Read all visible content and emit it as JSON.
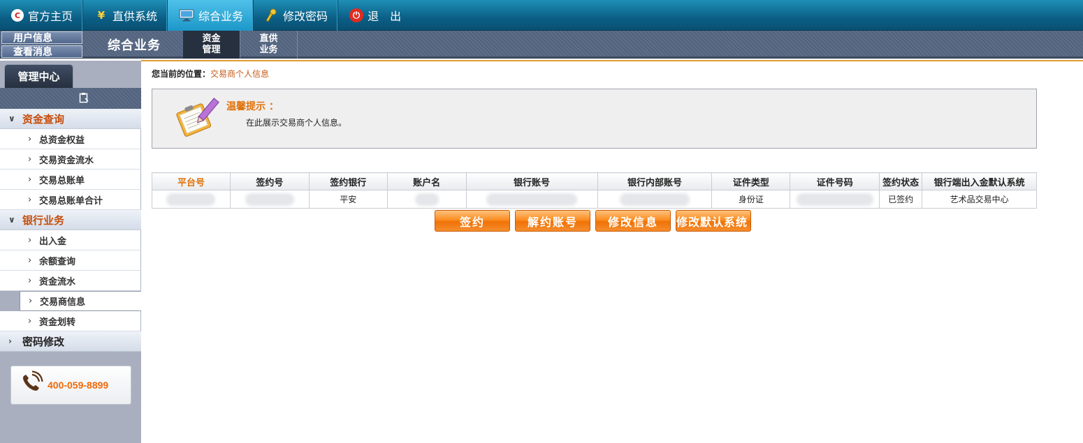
{
  "topnav": {
    "items": [
      {
        "label": "官方主页"
      },
      {
        "label": "直供系统"
      },
      {
        "label": "综合业务"
      },
      {
        "label": "修改密码"
      },
      {
        "label": "退　出"
      }
    ]
  },
  "secbar": {
    "user_info": "用户信息",
    "view_msg": "查看消息",
    "title": "综合业务",
    "tabs": [
      {
        "line1": "资金",
        "line2": "管理"
      },
      {
        "line1": "直供",
        "line2": "业务"
      }
    ]
  },
  "sidebar": {
    "tab": "管理中心",
    "groups": [
      {
        "label": "资金查询",
        "items": [
          "总资金权益",
          "交易资金流水",
          "交易总账单",
          "交易总账单合计"
        ]
      },
      {
        "label": "银行业务",
        "items": [
          "出入金",
          "余额查询",
          "资金流水",
          "交易商信息",
          "资金划转"
        ]
      },
      {
        "label": "密码修改",
        "items": []
      }
    ],
    "phone": "400-059-8899"
  },
  "main": {
    "crumb_label": "您当前的位置：",
    "crumb_current": "交易商个人信息",
    "tip_title": "温馨提示 ：",
    "tip_text": "在此展示交易商个人信息。",
    "table": {
      "headers": [
        "平台号",
        "签约号",
        "签约银行",
        "账户名",
        "银行账号",
        "银行内部账号",
        "证件类型",
        "证件号码",
        "签约状态",
        "银行端出入金默认系统"
      ],
      "row": [
        "",
        "",
        "平安",
        "",
        "",
        "",
        "身份证",
        "",
        "已签约",
        "艺术品交易中心"
      ]
    },
    "buttons": [
      "签约",
      "解约账号",
      "修改信息",
      "修改默认系统"
    ]
  }
}
